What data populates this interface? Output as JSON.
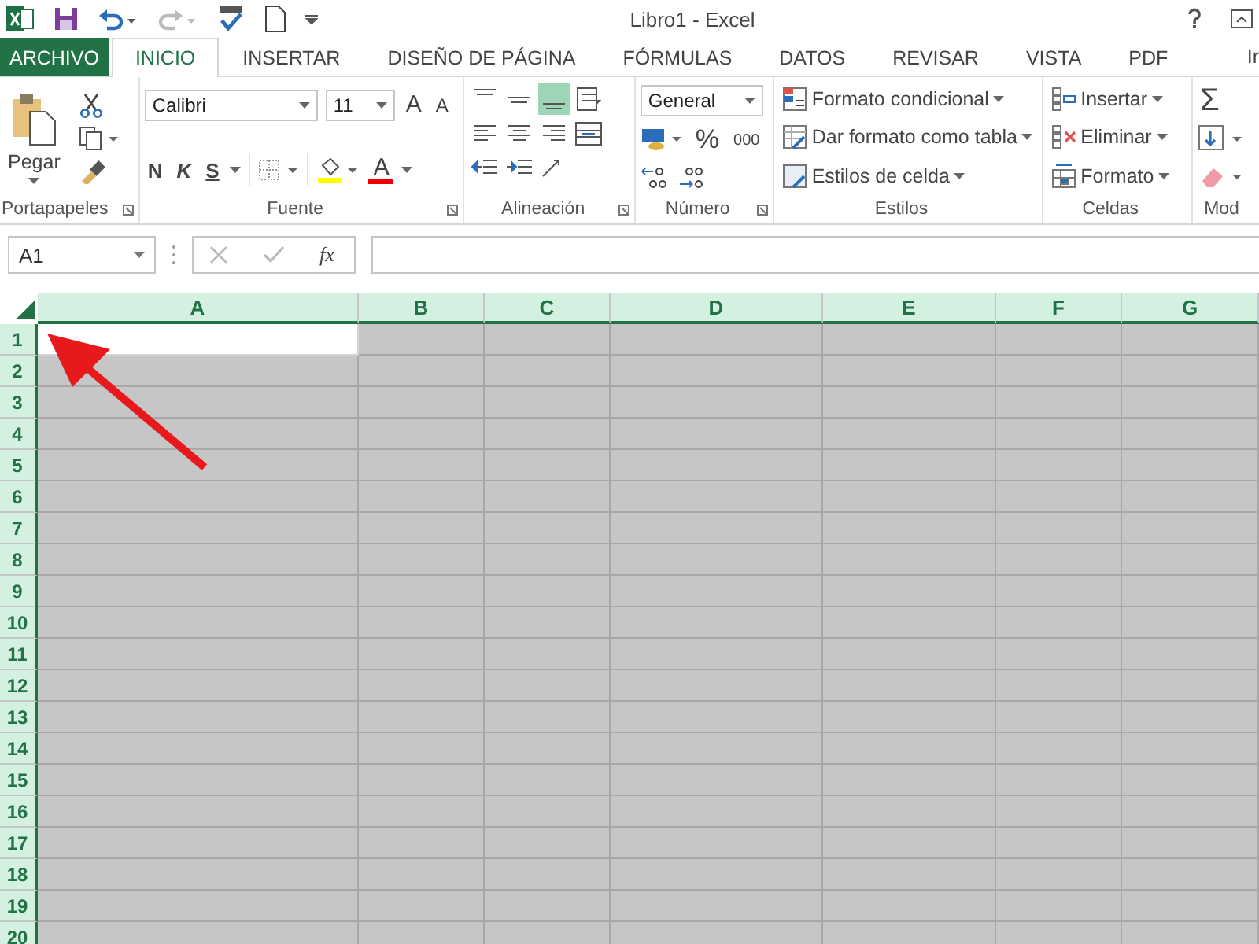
{
  "window": {
    "title": "Libro1 - Excel"
  },
  "tabs": [
    {
      "label": "ARCHIVO",
      "kind": "file",
      "selected": false
    },
    {
      "label": "INICIO",
      "kind": "tab",
      "selected": true
    },
    {
      "label": "INSERTAR",
      "kind": "tab",
      "selected": false
    },
    {
      "label": "DISEÑO DE PÁGINA",
      "kind": "tab",
      "selected": false
    },
    {
      "label": "FÓRMULAS",
      "kind": "tab",
      "selected": false
    },
    {
      "label": "DATOS",
      "kind": "tab",
      "selected": false
    },
    {
      "label": "REVISAR",
      "kind": "tab",
      "selected": false
    },
    {
      "label": "VISTA",
      "kind": "tab",
      "selected": false
    },
    {
      "label": "PDF",
      "kind": "tab",
      "selected": false
    }
  ],
  "account": "Ir",
  "ribbon": {
    "clipboard": {
      "paste": "Pegar",
      "label": "Portapapeles"
    },
    "font": {
      "name": "Calibri",
      "size": "11",
      "grow": "A",
      "shrink": "A",
      "bold": "N",
      "italic": "K",
      "underline": "S",
      "color_letter": "A",
      "label": "Fuente"
    },
    "alignment": {
      "label": "Alineación",
      "buttons": [
        {
          "kind": "top",
          "selected": false
        },
        {
          "kind": "middle",
          "selected": false
        },
        {
          "kind": "bottom",
          "selected": true
        },
        {
          "kind": "wrap",
          "selected": false
        },
        {
          "kind": "left",
          "selected": false
        },
        {
          "kind": "center",
          "selected": false
        },
        {
          "kind": "right",
          "selected": false
        },
        {
          "kind": "merge",
          "selected": false
        },
        {
          "kind": "outdent",
          "selected": false
        },
        {
          "kind": "indent",
          "selected": false
        },
        {
          "kind": "orient",
          "selected": false
        }
      ]
    },
    "number": {
      "format": "General",
      "percent": "%",
      "thousands": "000",
      "label": "Número"
    },
    "styles": {
      "label": "Estilos",
      "buttons": [
        {
          "kind": "conditional",
          "label": "Formato condicional"
        },
        {
          "kind": "table",
          "label": "Dar formato como tabla"
        },
        {
          "kind": "cellstyle",
          "label": "Estilos de celda"
        }
      ]
    },
    "cells": {
      "label": "Celdas",
      "buttons": [
        {
          "kind": "insert",
          "label": "Insertar"
        },
        {
          "kind": "delete",
          "label": "Eliminar"
        },
        {
          "kind": "format",
          "label": "Formato"
        }
      ]
    },
    "editing": {
      "sum": "Σ",
      "label": "Mod"
    }
  },
  "formula_bar": {
    "name_box": "A1",
    "fx": "fx"
  },
  "sheet": {
    "columns": [
      {
        "label": "A",
        "selected": true,
        "active": true
      },
      {
        "label": "B",
        "selected": true,
        "active": false
      },
      {
        "label": "C",
        "selected": true,
        "active": false
      },
      {
        "label": "D",
        "selected": true,
        "active": false
      },
      {
        "label": "E",
        "selected": true,
        "active": false
      },
      {
        "label": "F",
        "selected": true,
        "active": false
      },
      {
        "label": "G",
        "selected": true,
        "active": false
      }
    ],
    "rows": [
      {
        "label": "1",
        "selected": true,
        "active": true
      },
      {
        "label": "2",
        "selected": true,
        "active": false
      },
      {
        "label": "3",
        "selected": true,
        "active": false
      },
      {
        "label": "4",
        "selected": true,
        "active": false
      },
      {
        "label": "5",
        "selected": true,
        "active": false
      },
      {
        "label": "6",
        "selected": true,
        "active": false
      },
      {
        "label": "7",
        "selected": true,
        "active": false
      },
      {
        "label": "8",
        "selected": true,
        "active": false
      },
      {
        "label": "9",
        "selected": true,
        "active": false
      },
      {
        "label": "10",
        "selected": true,
        "active": false
      },
      {
        "label": "11",
        "selected": true,
        "active": false
      },
      {
        "label": "12",
        "selected": true,
        "active": false
      },
      {
        "label": "13",
        "selected": true,
        "active": false
      },
      {
        "label": "14",
        "selected": true,
        "active": false
      },
      {
        "label": "15",
        "selected": true,
        "active": false
      },
      {
        "label": "16",
        "selected": true,
        "active": false
      },
      {
        "label": "17",
        "selected": true,
        "active": false
      },
      {
        "label": "18",
        "selected": true,
        "active": false
      },
      {
        "label": "19",
        "selected": true,
        "active": false
      },
      {
        "label": "20",
        "selected": true,
        "active": false
      }
    ]
  }
}
